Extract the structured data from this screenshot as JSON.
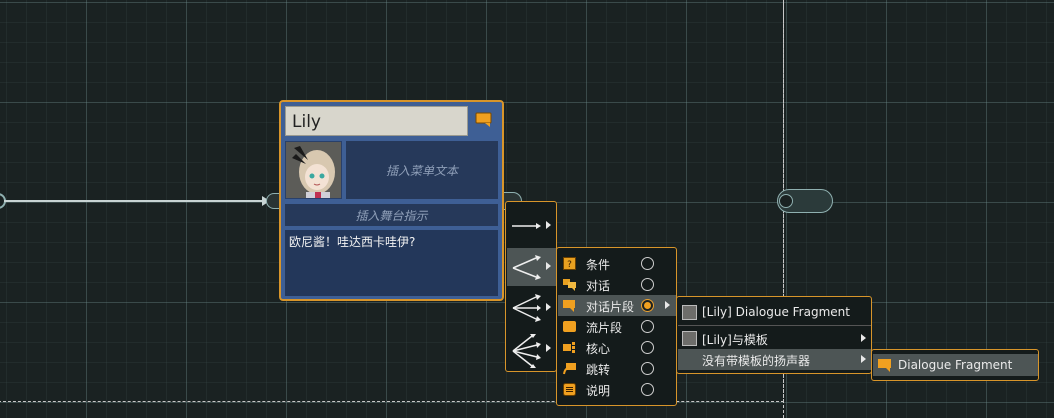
{
  "node": {
    "speaker": "Lily",
    "menu_text_placeholder": "插入菜单文本",
    "stage_directions_placeholder": "插入舞台指示",
    "dialogue_text": "欧尼酱！哇达西卡哇伊?"
  },
  "create_menu": {
    "level2": {
      "items": [
        {
          "label": "条件",
          "icon": "condition-icon"
        },
        {
          "label": "对话",
          "icon": "dialogue-icon"
        },
        {
          "label": "对话片段",
          "icon": "dialogue-fragment-icon",
          "selected": true
        },
        {
          "label": "流片段",
          "icon": "flow-fragment-icon"
        },
        {
          "label": "核心",
          "icon": "hub-icon"
        },
        {
          "label": "跳转",
          "icon": "jump-icon"
        },
        {
          "label": "说明",
          "icon": "comment-icon"
        }
      ]
    },
    "level3": {
      "items": [
        {
          "label": "[Lily] Dialogue Fragment"
        },
        {
          "label": "[Lily]与模板"
        },
        {
          "label": "没有带模板的扬声器"
        }
      ]
    },
    "level4": {
      "items": [
        {
          "label": "Dialogue Fragment"
        }
      ]
    }
  },
  "colors": {
    "accent": "#d8952a",
    "node_bg": "#3e5f95",
    "canvas_bg": "#1a2222",
    "menu_highlight": "#4d5555"
  }
}
